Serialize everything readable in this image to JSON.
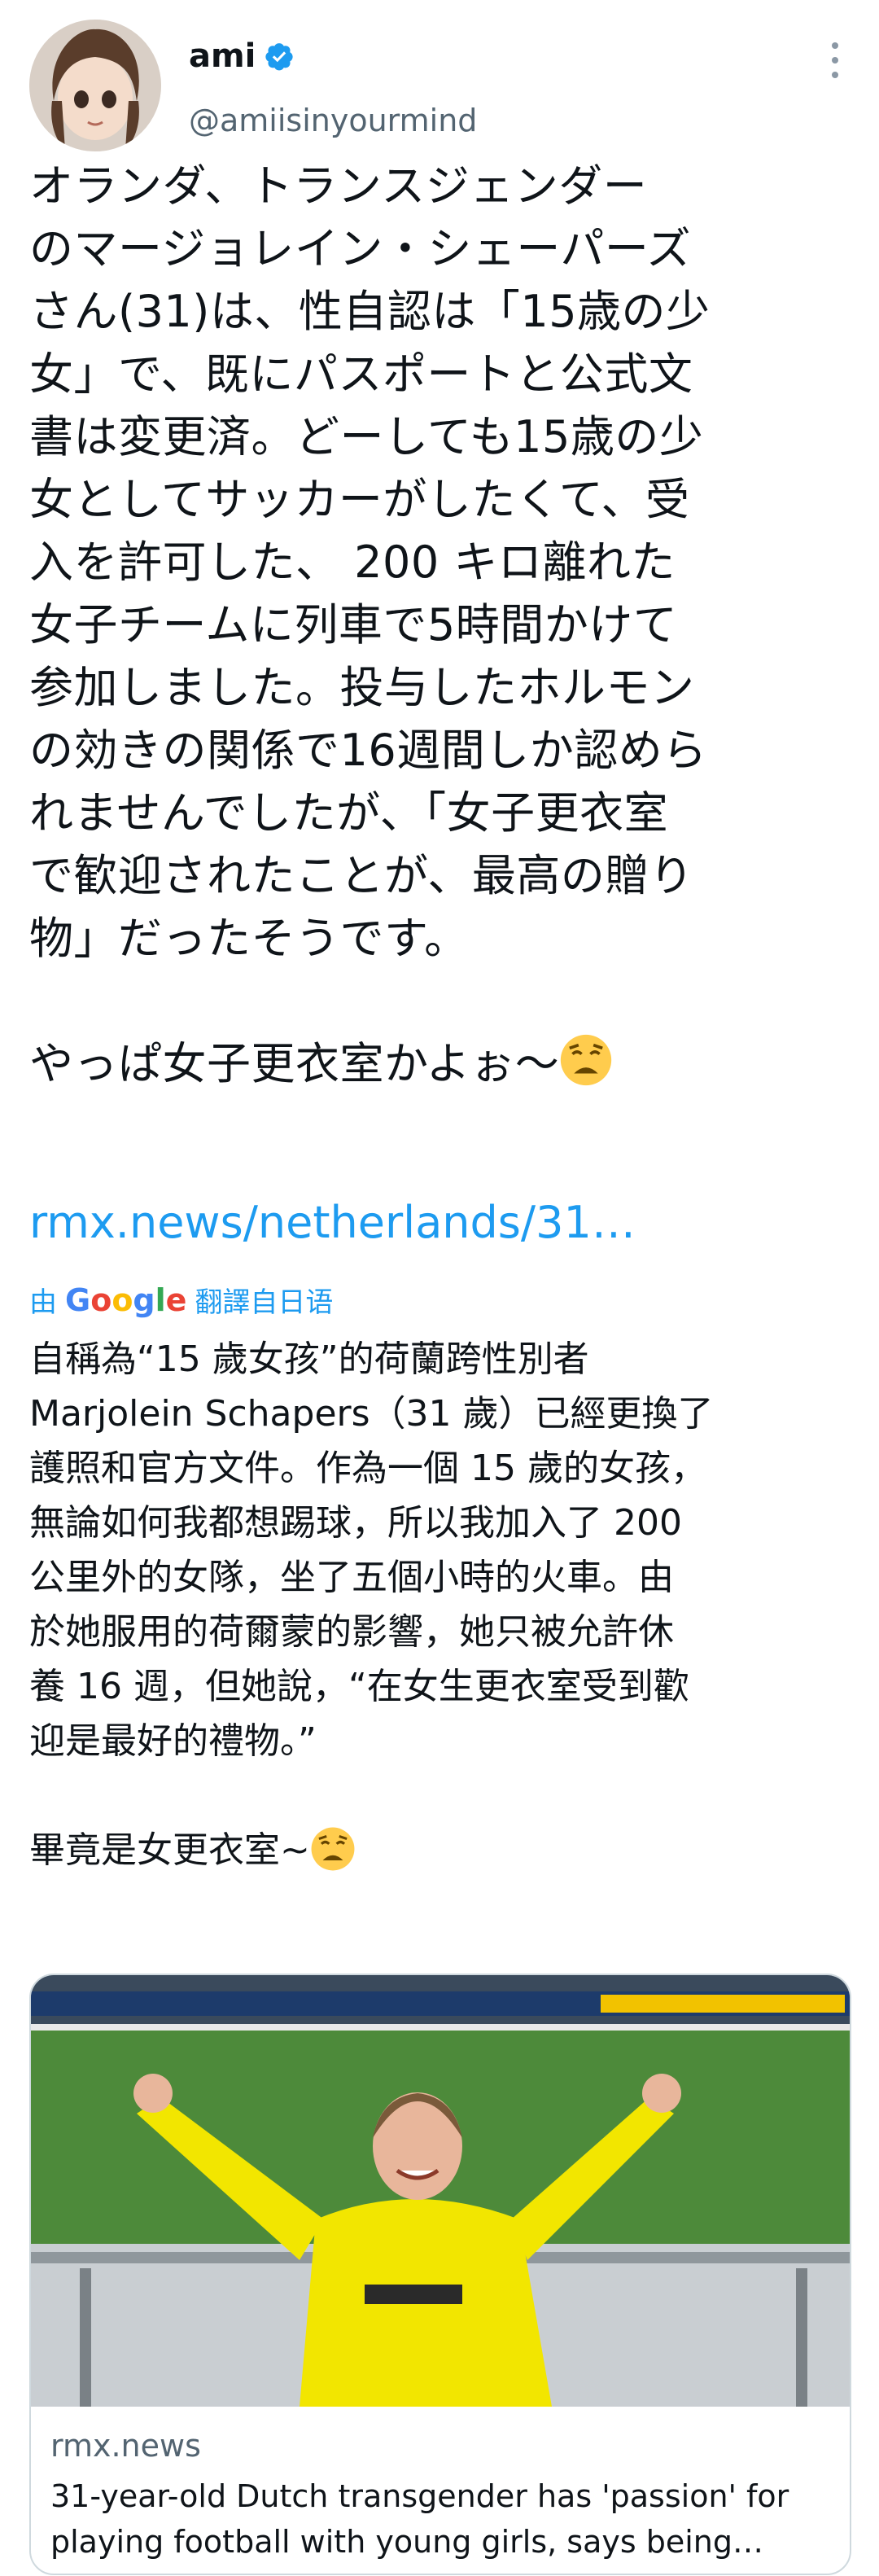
{
  "author": {
    "display_name": "ami",
    "handle": "@amiisinyourmind",
    "verified": true
  },
  "tweet": {
    "text": "オランダ、トランスジェンダー\nのマージョレイン・シェーパーズ\nさん(31)は、性自認は「15歳の少\n女」で、既にパスポートと公式文\n書は変更済。どーしても15歳の少\n女としてサッカーがしたくて、受\n入を許可した、 200 キロ離れた\n女子チームに列車で5時間かけて\n参加しました。投与したホルモン\nの効きの関係で16週間しか認めら\nれませんでしたが、「女子更衣室\nで歓迎されたことが、最高の贈り\n物」だったそうです。\n\nやっぱ女子更衣室かよぉ〜",
    "link": "rmx.news/netherlands/31…"
  },
  "translation": {
    "prefix": "由",
    "provider": "Google",
    "suffix": "翻譯自日语",
    "text": "自稱為“15 歲女孩”的荷蘭跨性別者\nMarjolein Schapers（31 歲）已經更換了\n護照和官方文件。作為一個 15 歲的女孩，\n無論如何我都想踢球，所以我加入了 200\n公里外的女隊，坐了五個小時的火車。由\n於她服用的荷爾蒙的影響，她只被允許休\n養 16 週，但她說，“在女生更衣室受到歡\n迎是最好的禮物。”\n\n畢竟是女更衣室~"
  },
  "card": {
    "domain": "rmx.news",
    "title": "31-year-old Dutch transgender has 'passion' for playing football with young girls, says being…",
    "image_description_icon": "photo-person-thumbs-up"
  },
  "icons": {
    "verified": "verified-badge-icon",
    "more": "more-vertical-icon",
    "emoji": "weary-face-emoji"
  },
  "colors": {
    "link": "#1d9bf0",
    "secondary_text": "#536471",
    "verified": "#1d9bf0"
  }
}
